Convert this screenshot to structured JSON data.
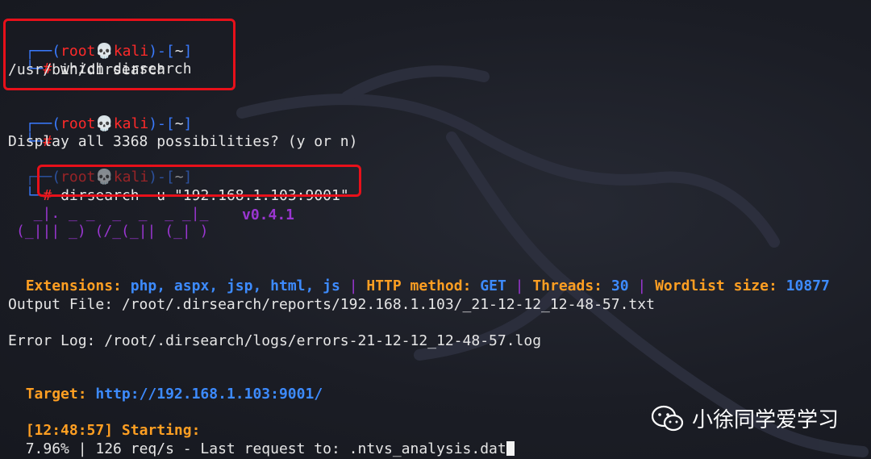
{
  "prompt": {
    "open": "┌──(",
    "user": "root",
    "skull": "💀",
    "host": "kali",
    "mid": ")-[",
    "dir": "~",
    "close": "]",
    "arrow": "└─",
    "hash": "#"
  },
  "block1": {
    "command": " which dirsearch",
    "output": "/usr/bin/dirsearch"
  },
  "block2": {
    "message": "Display all 3368 possibilities? (y or n)"
  },
  "block3": {
    "command": "dirsearch -u \"192.168.1.103:9001\""
  },
  "banner": {
    "art_line1": "  _|. _ _  _  _  _ _|_",
    "art_line2": "(_||| _) (/_(_|| (_| )",
    "version": "v0.4.1"
  },
  "config": {
    "ext_label": "Extensions:",
    "ext_value": "php, aspx, jsp, html, js",
    "sep": "|",
    "method_label": "HTTP method:",
    "method_value": "GET",
    "threads_label": "Threads:",
    "threads_value": "30",
    "wordlist_label": "Wordlist size:",
    "wordlist_value": "10877"
  },
  "output_file": "Output File: /root/.dirsearch/reports/192.168.1.103/_21-12-12_12-48-57.txt",
  "error_log": "Error Log: /root/.dirsearch/logs/errors-21-12-12_12-48-57.log",
  "target": {
    "label": "Target:",
    "url": "http://192.168.1.103:9001/"
  },
  "starting": "[12:48:57] Starting:",
  "progress": "7.96% | 126 req/s - Last request to: .ntvs_analysis.dat",
  "watermark": {
    "text": "小徐同学爱学习",
    "icon": "wechat-icon"
  },
  "colors": {
    "background": "#1c1e26",
    "prompt_blue": "#3a7bff",
    "prompt_red": "#ff2a2a",
    "label_orange": "#ff9f22",
    "value_blue": "#3d8bff",
    "banner_purple": "#9a36d1",
    "highlight_red": "#e8101a"
  }
}
